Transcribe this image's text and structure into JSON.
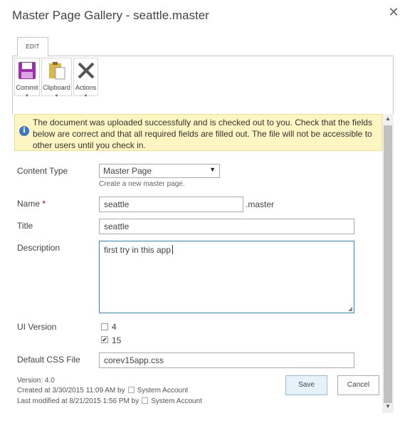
{
  "dialog": {
    "title": "Master Page Gallery - seattle.master",
    "close_glyph": "✕"
  },
  "ribbon": {
    "tab_label": "EDIT",
    "groups": [
      {
        "label": "Commit",
        "icon": "save-icon"
      },
      {
        "label": "Clipboard",
        "icon": "clipboard-icon"
      },
      {
        "label": "Actions",
        "icon": "delete-icon"
      }
    ]
  },
  "status": {
    "info_glyph": "i",
    "message": "The document was uploaded successfully and is checked out to you. Check that the fields below are correct and that all required fields are filled out. The file will not be accessible to other users until you check in."
  },
  "form": {
    "content_type": {
      "label": "Content Type",
      "selected": "Master Page",
      "helper": "Create a new master page."
    },
    "name": {
      "label": "Name",
      "required_mark": "*",
      "value": "seattle",
      "suffix": ".master"
    },
    "title": {
      "label": "Title",
      "value": "seattle"
    },
    "description": {
      "label": "Description",
      "value": "first try in this app"
    },
    "ui_version": {
      "label": "UI Version",
      "options": [
        {
          "label": "4",
          "checked": false
        },
        {
          "label": "15",
          "checked": true
        }
      ]
    },
    "default_css": {
      "label": "Default CSS File",
      "value": "corev15app.css"
    }
  },
  "meta": {
    "version": "Version: 4.0",
    "created_prefix": "Created at 3/30/2015 11:09 AM  by",
    "created_by": "System Account",
    "modified_prefix": "Last modified at 8/21/2015 1:56 PM  by",
    "modified_by": "System Account"
  },
  "buttons": {
    "save": "Save",
    "cancel": "Cancel"
  },
  "colors": {
    "info": "#3a78c2",
    "status_bg": "#fdf6c3",
    "focus_border": "#2a8dd4",
    "save_icon": "#9b2fae"
  }
}
